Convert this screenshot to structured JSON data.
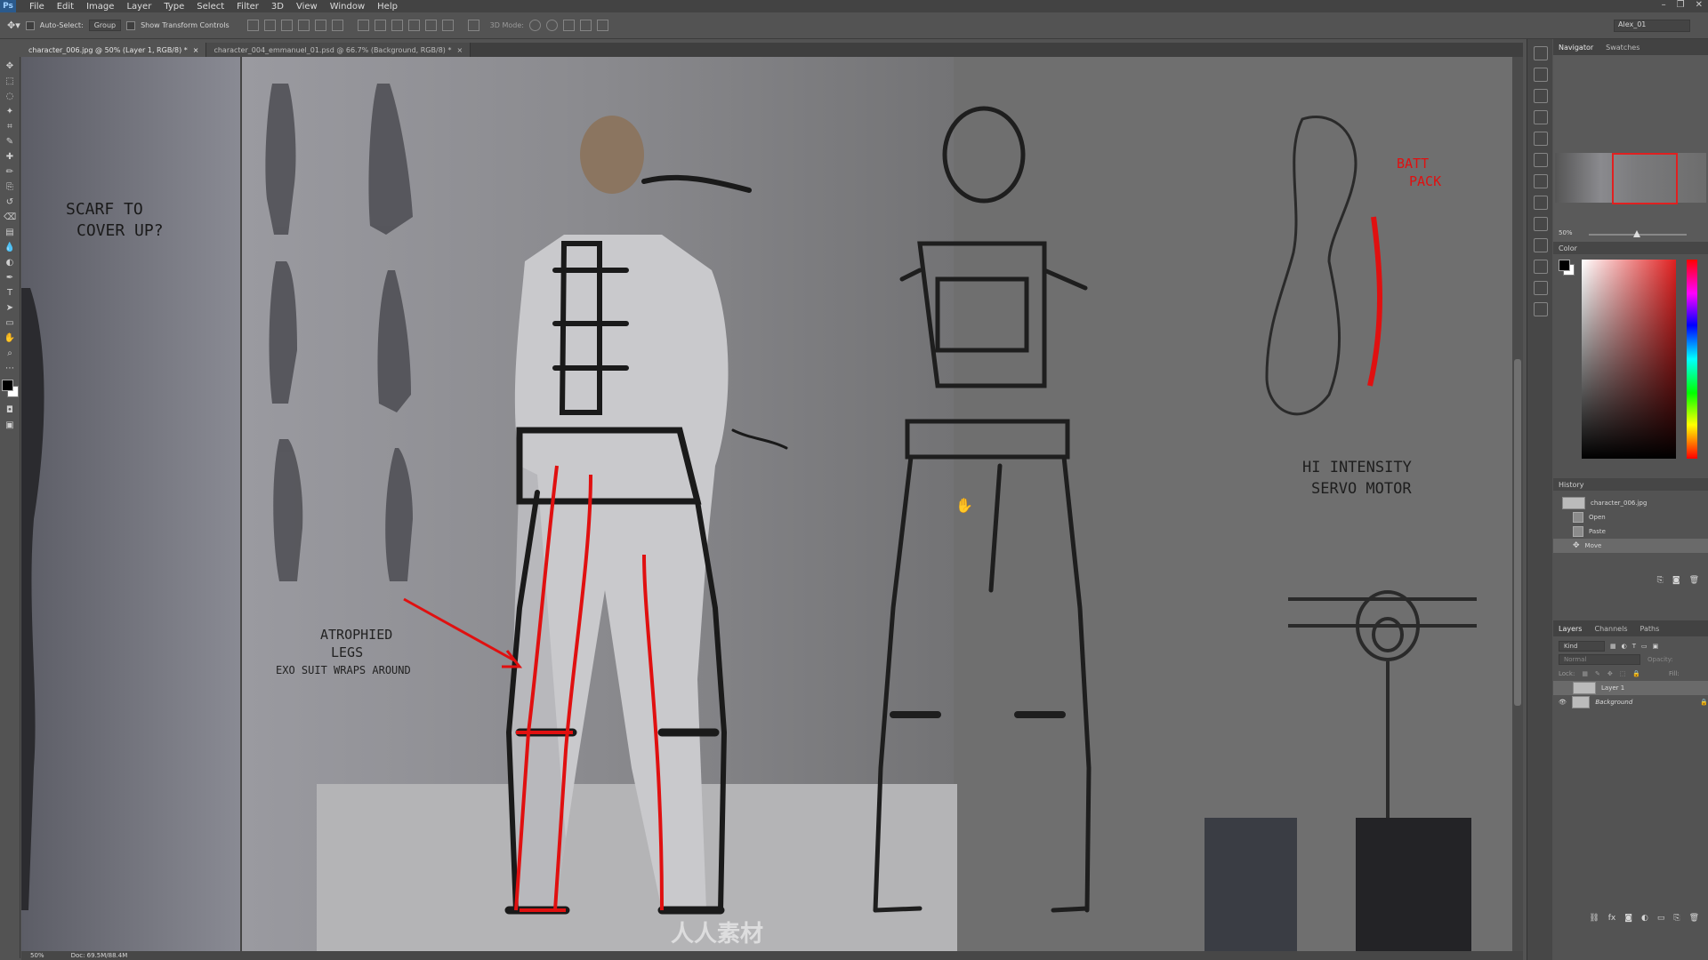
{
  "app": {
    "logo": "Ps"
  },
  "menu": [
    "File",
    "Edit",
    "Image",
    "Layer",
    "Type",
    "Select",
    "Filter",
    "3D",
    "View",
    "Window",
    "Help"
  ],
  "window_controls": [
    "–",
    "❐",
    "✕"
  ],
  "options": {
    "auto_select_label": "Auto-Select:",
    "group_value": "Group",
    "transform_label": "Show Transform Controls",
    "mode_label": "3D Mode:",
    "workspace_value": "Alex_01"
  },
  "tabs": [
    {
      "label": "character_006.jpg @ 50% (Layer 1, RGB/8) *",
      "close": "×"
    },
    {
      "label": "character_004_emmanuel_01.psd @ 66.7% (Background, RGB/8) *",
      "close": "×"
    }
  ],
  "tools": [
    "move-tool-icon",
    "marquee-tool-icon",
    "lasso-tool-icon",
    "magic-wand-icon",
    "crop-tool-icon",
    "eyedropper-icon",
    "healing-brush-icon",
    "brush-tool-icon",
    "clone-stamp-icon",
    "history-brush-icon",
    "eraser-icon",
    "gradient-icon",
    "blur-icon",
    "dodge-icon",
    "pen-tool-icon",
    "type-tool-icon",
    "path-select-icon",
    "shape-tool-icon",
    "hand-tool-icon",
    "zoom-tool-icon"
  ],
  "tool_glyphs": [
    "✥",
    "⬚",
    "◌",
    "✦",
    "⌗",
    "✎",
    "✚",
    "✏",
    "⎘",
    "↺",
    "⌫",
    "▤",
    "💧",
    "◐",
    "✒",
    "T",
    "➤",
    "▭",
    "✋",
    "⌕"
  ],
  "canvas_notes": {
    "note1_line1": "SCARF TO",
    "note1_line2": "COVER UP?",
    "note2_line1": "ATROPHIED",
    "note2_line2": "LEGS",
    "note2_line3": "EXO SUIT WRAPS AROUND",
    "note3_line1": "BATT",
    "note3_line2": "PACK",
    "note4_line1": "HI INTENSITY",
    "note4_line2": "SERVO MOTOR",
    "watermark": "人人素材"
  },
  "status": {
    "zoom": "50%",
    "doc": "Doc: 69.5M/88.4M"
  },
  "panels": {
    "navigator_tabs": [
      "Navigator",
      "Swatches"
    ],
    "nav_zoom": "50%",
    "color_title": "Color",
    "history_title": "History",
    "history_snapshot": "character_006.jpg",
    "history_items": [
      "Open",
      "Paste",
      "Move"
    ],
    "layers_tabs": [
      "Layers",
      "Channels",
      "Paths"
    ],
    "layers_kind": "Kind",
    "blend_mode": "Normal",
    "opacity_label": "Opacity:",
    "lock_label": "Lock:",
    "fill_label": "Fill:",
    "layers": [
      "Layer 1",
      "Background"
    ]
  },
  "colors": {
    "foreground": "#000000",
    "background": "#ffffff",
    "accent_red": "#e01010"
  }
}
